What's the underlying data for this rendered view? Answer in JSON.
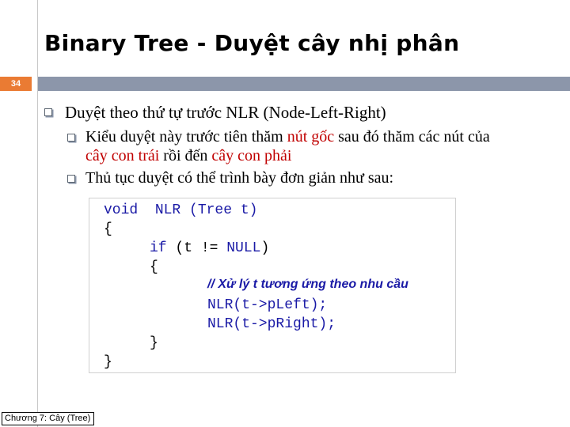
{
  "slide": {
    "title": "Binary Tree - Duyệt cây nhị phân",
    "page_number": "34",
    "colors": {
      "band": "#8c96aa",
      "page_tag": "#ea7b33",
      "highlight": "#c00000",
      "code_keyword": "#1a1aa6"
    }
  },
  "content": {
    "level1": {
      "text": "Duyệt theo thứ tự trước NLR (Node-Left-Right)"
    },
    "bullet2_1": {
      "part1": "Kiểu duyệt này trước tiên thăm ",
      "highlight1": "nút gốc",
      "part2": " sau đó thăm các nút của",
      "highlight2": "cây con trái",
      "part3": " rồi đến ",
      "highlight3": "cây con phải"
    },
    "bullet2_2": {
      "text": "Thủ tục duyệt có thể trình bày đơn giản như sau:"
    }
  },
  "code": {
    "line1_kw": "void",
    "line1_rest": "  NLR (Tree t)",
    "line2": "{",
    "line3_kw": "if",
    "line3_rest": " (t != ",
    "line3_null": "NULL",
    "line3_end": ")",
    "line4": "{",
    "comment": "// Xử lý t tương ứng theo nhu cầu",
    "line6": "NLR(t->pLeft);",
    "line7": "NLR(t->pRight);",
    "line8": "}",
    "line9": "}"
  },
  "footer": {
    "text": "Chương 7: Cây (Tree)"
  }
}
